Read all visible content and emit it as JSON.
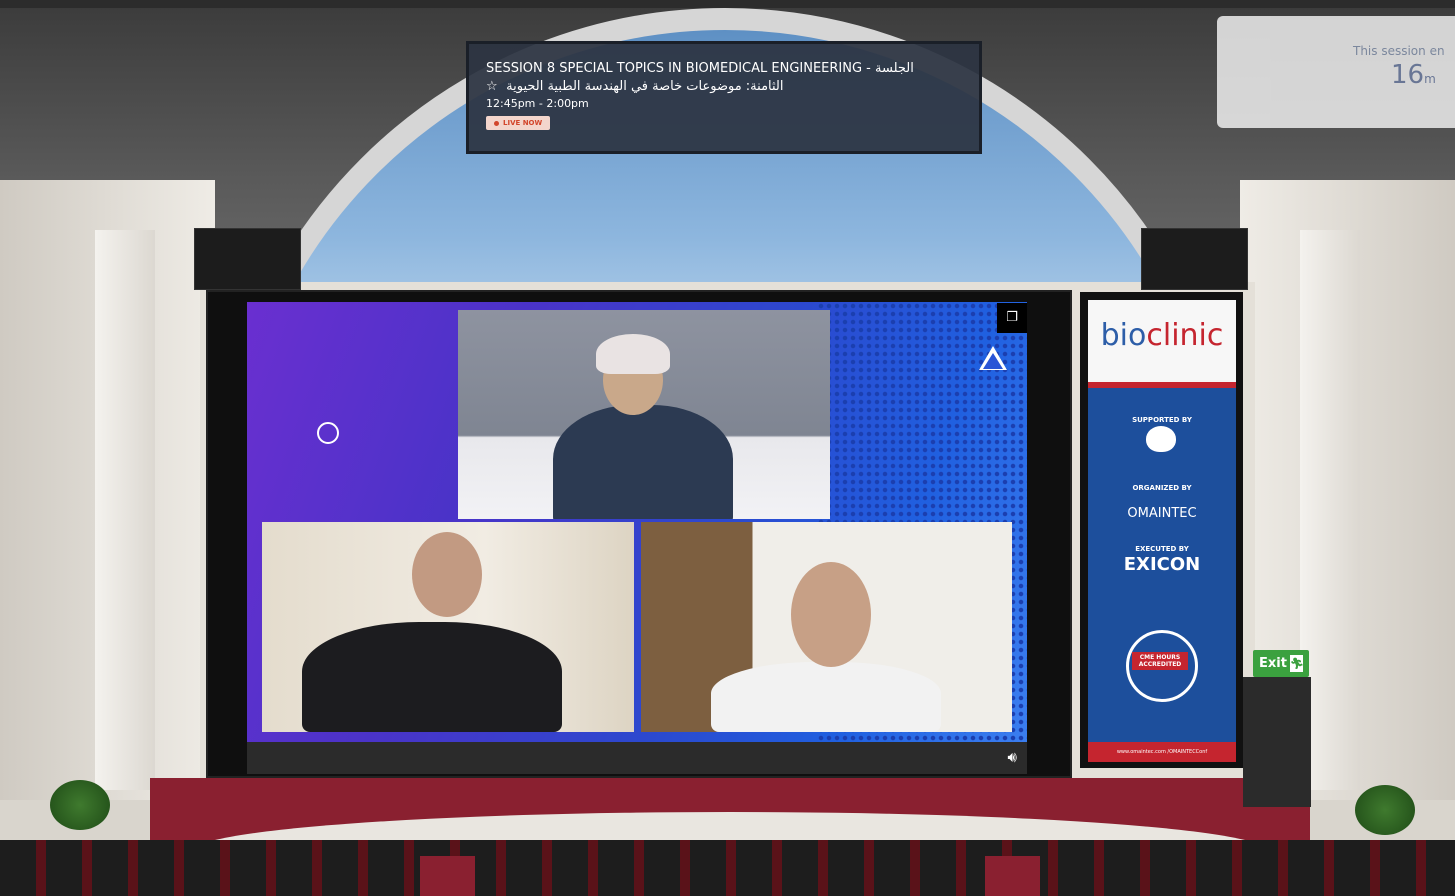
{
  "session": {
    "title_line1": "SESSION 8 SPECIAL TOPICS IN BIOMEDICAL ENGINEERING - الجلسة",
    "title_line2": "الثامنة: موضوعات خاصة في الهندسة الطبية الحيوية",
    "time": "12:45pm - 2:00pm",
    "live_label": "LIVE NOW",
    "favorite_icon": "star-icon"
  },
  "session_end": {
    "text": "This session en",
    "count": "16",
    "unit": "m"
  },
  "video": {
    "popout_icon": "popout-icon",
    "volume_icon": "volume-icon"
  },
  "side_banner": {
    "logo_bio": "bio",
    "logo_clinic": "clinic",
    "supported_label": "SUPPORTED BY",
    "organized_label": "ORGANIZED BY",
    "organizer": "OMAINTEC",
    "executed_label": "EXECUTED BY",
    "executor": "EXICON",
    "cme_badge": "CME HOURS ACCREDITED",
    "footer": "www.omaintec.com /OMAINTECConf"
  },
  "exit": {
    "label": "Exit",
    "icon": "exit-icon"
  },
  "colors": {
    "live_red": "#d2452b",
    "exit_green": "#3ba13f",
    "brand_red": "#c5252f",
    "brand_blue": "#1d4f9c"
  }
}
